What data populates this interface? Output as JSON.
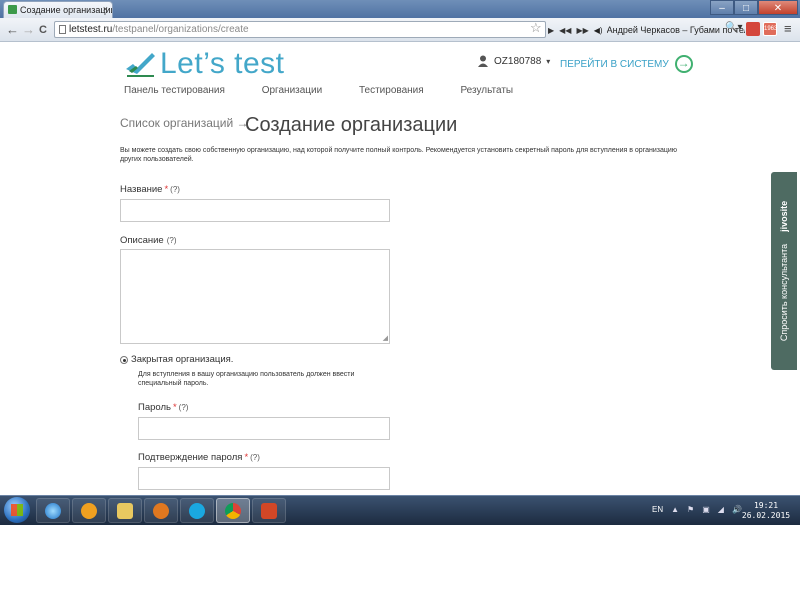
{
  "browser": {
    "tab_title": "Создание организации -",
    "tab_close": "×",
    "win_min": "–",
    "win_max": "□",
    "win_close": "✕",
    "back": "←",
    "forward": "→",
    "reload": "C",
    "url_host": "letstest.ru",
    "url_path": "/testpanel/organizations/create",
    "star": "☆",
    "media_play": "▶",
    "media_prev": "◀◀",
    "media_next": "▶▶",
    "track": "Андрей Черкасов – Губами по тел",
    "ext_search": "🔍▾",
    "ext_badge": "1963",
    "menu": "≡"
  },
  "site": {
    "logo_text": "Let’s test",
    "user_name": "OZ180788",
    "user_caret": "▾",
    "enter_system": "ПЕРЕЙТИ В СИСТЕМУ",
    "enter_arrow": "→",
    "nav": [
      "Панель тестирования",
      "Организации",
      "Тестирования",
      "Результаты"
    ]
  },
  "form": {
    "breadcrumb": "Список организаций →",
    "title": "Создание организации",
    "description": "Вы можете создать свою собственную организацию, над которой получите полный контроль. Рекомендуется установить секретный пароль для вступления в организацию других пользователей.",
    "name_label": "Название",
    "required_mark": "*",
    "help_mark": "(?)",
    "name_value": "",
    "description_label": "Описание",
    "description_value": "",
    "resize_mark": "◢",
    "closed_org_label": "Закрытая организация.",
    "closed_org_help": "Для вступления в вашу организацию пользователь должен ввести специальный пароль.",
    "password_label": "Пароль",
    "password_value": "",
    "password_confirm_label": "Подтверждение пароля",
    "password_confirm_value": ""
  },
  "jivo": {
    "label": "Спросить консультанта",
    "brand": "jivosite"
  },
  "taskbar": {
    "lang": "EN",
    "tray_icons": [
      "▲",
      "⚑",
      "▣",
      "◢",
      "🔊"
    ],
    "time": "19:21",
    "date": "26.02.2015"
  },
  "colors": {
    "brand_blue": "#43a7c9",
    "brand_green": "#40b070",
    "required_red": "#dd3333",
    "jivo_bg": "#4e6b62"
  }
}
